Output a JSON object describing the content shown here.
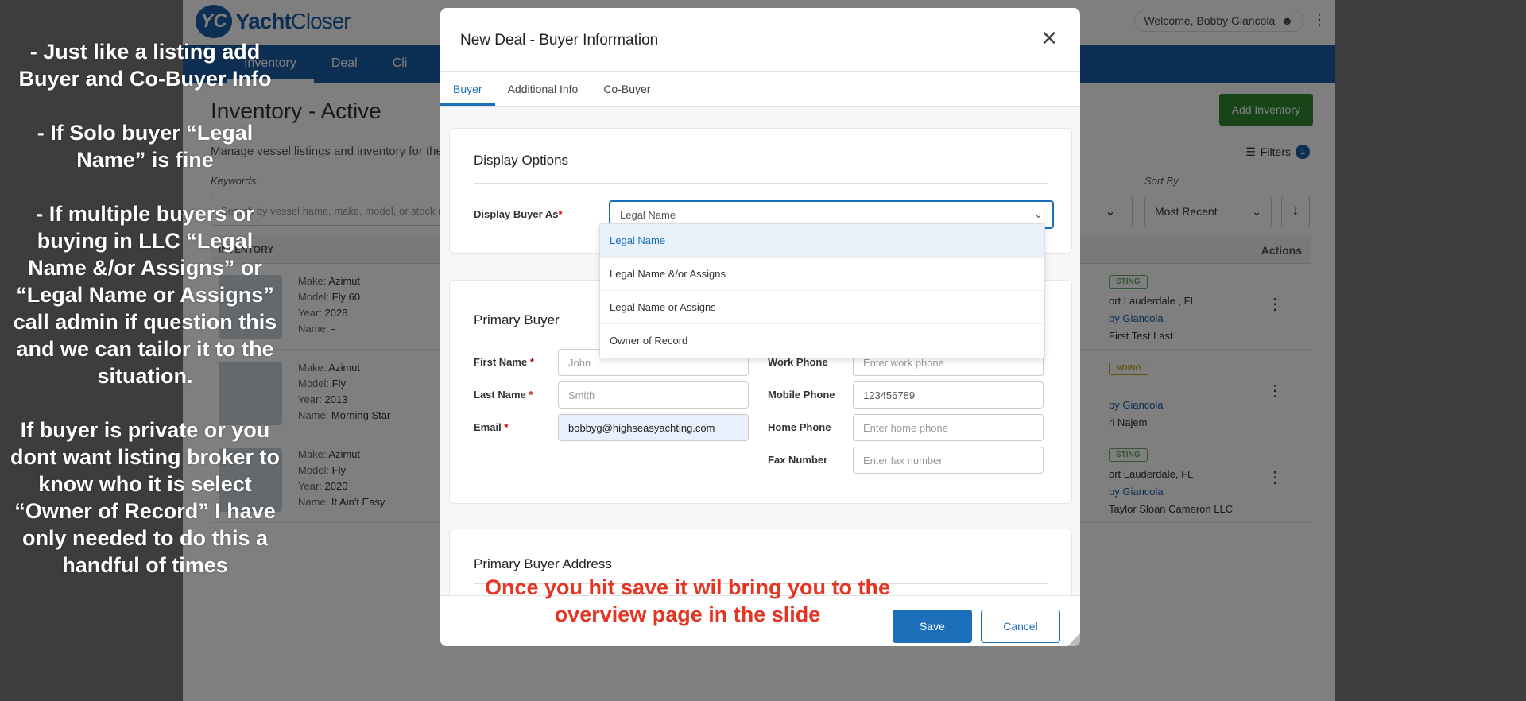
{
  "app": {
    "logo_mark": "YC",
    "logo_text_a": "Yacht",
    "logo_text_b": "Closer",
    "welcome": "Welcome, Bobby Giancola",
    "nav": [
      "Inventory",
      "Deal",
      "Cli"
    ],
    "page_title": "Inventory - Active",
    "page_sub": "Manage vessel listings and inventory for the",
    "keywords_label": "Keywords:",
    "search_placeholder": "Search by vessel name, make, model, or stock n",
    "add_inventory": "Add Inventory",
    "filters_label": "Filters",
    "filters_count": "1",
    "sort_label": "Sort By",
    "sort_value": "Most Recent",
    "th_inventory": "INVENTORY",
    "th_actions": "Actions",
    "rows": [
      {
        "make": "Azimut",
        "model": "Fly 60",
        "year": "2028",
        "name": "-",
        "status": "STING",
        "loc1": "ort Lauderdale , FL",
        "agent": "by Giancola",
        "loc3": "First Test Last"
      },
      {
        "make": "Azimut",
        "model": "Fly",
        "year": "2013",
        "name": "Morning Star",
        "status": "NDING",
        "loc1": "",
        "agent": "by Giancola",
        "loc3": "ri Najem"
      },
      {
        "make": "Azimut",
        "model": "Fly",
        "year": "2020",
        "name": "It Ain't Easy",
        "status": "STING",
        "loc1": "ort Lauderdale, FL",
        "agent": "by Giancola",
        "loc3": "Taylor Sloan Cameron LLC"
      }
    ]
  },
  "labels": {
    "make": "Make:",
    "model": "Model:",
    "year": "Year:",
    "name": "Name:"
  },
  "notes": {
    "left": [
      "- Just like a listing add Buyer and Co-Buyer Info",
      "- If Solo buyer “Legal Name” is fine",
      "- If multiple buyers or buying in LLC “Legal Name &/or Assigns” or “Legal Name or Assigns” call admin if question this and we can tailor it to the situation.",
      "If buyer is private or you dont want listing broker to know who it is select “Owner of Record” I have only needed to do this a handful of times"
    ],
    "red": "Once you hit save it wil bring you to the overview page in the slide"
  },
  "modal": {
    "title": "New Deal - Buyer Information",
    "tabs": [
      "Buyer",
      "Additional Info",
      "Co-Buyer"
    ],
    "display_options": {
      "title": "Display Options",
      "label": "Display Buyer As",
      "value": "Legal Name",
      "options": [
        "Legal Name",
        "Legal Name &/or Assigns",
        "Legal Name or Assigns",
        "Owner of Record"
      ]
    },
    "primary_buyer": {
      "title": "Primary Buyer",
      "first_name_label": "First Name",
      "first_name_placeholder": "John",
      "last_name_label": "Last Name",
      "last_name_placeholder": "Smith",
      "email_label": "Email",
      "email_value": "bobbyg@highseasyachting.com",
      "work_phone_label": "Work Phone",
      "work_phone_placeholder": "Enter work phone",
      "mobile_phone_label": "Mobile Phone",
      "mobile_phone_value": "123456789",
      "home_phone_label": "Home Phone",
      "home_phone_placeholder": "Enter home phone",
      "fax_label": "Fax Number",
      "fax_placeholder": "Enter fax number"
    },
    "address_title": "Primary Buyer Address",
    "save": "Save",
    "cancel": "Cancel"
  }
}
